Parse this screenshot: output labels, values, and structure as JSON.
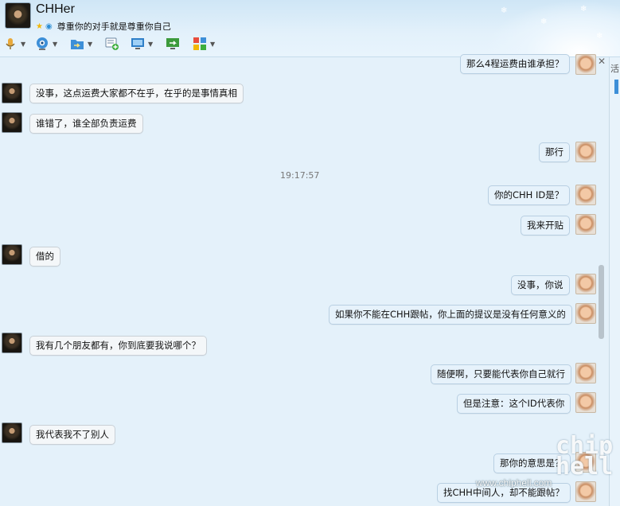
{
  "header": {
    "contact_name": "CHHer",
    "signature": "尊重你的对手就是尊重你自己",
    "icons": [
      "microphone-icon",
      "video-camera-icon",
      "folder-transfer-icon",
      "message-add-icon",
      "screen-share-icon",
      "remote-assist-icon",
      "apps-grid-icon"
    ]
  },
  "timestamp": "19:17:57",
  "messages": [
    {
      "side": "me",
      "text": "那么4程运费由谁承担？"
    },
    {
      "side": "them",
      "text": "没事，这点运费大家都不在乎，在乎的是事情真相"
    },
    {
      "side": "them",
      "text": "谁错了，谁全部负责运费"
    },
    {
      "side": "me",
      "text": "那行"
    },
    {
      "side": "me",
      "text": "你的CHH ID是？"
    },
    {
      "side": "me",
      "text": "我来开贴"
    },
    {
      "side": "them",
      "text": "借的"
    },
    {
      "side": "me",
      "text": "没事，你说"
    },
    {
      "side": "me",
      "text": "如果你不能在CHH跟帖，你上面的提议是没有任何意义的"
    },
    {
      "side": "them",
      "text": "我有几个朋友都有，你到底要我说哪个？"
    },
    {
      "side": "me",
      "text": "随便啊，只要能代表你自己就行"
    },
    {
      "side": "me",
      "text": "但是注意：这个ID代表你"
    },
    {
      "side": "them",
      "text": "我代表我不了别人"
    },
    {
      "side": "me",
      "text": "那你的意思是？"
    },
    {
      "side": "me",
      "text": "找CHH中间人，却不能跟帖？"
    }
  ],
  "sidebar": {
    "partial_text": "活"
  },
  "watermark": {
    "logo": "chip hell",
    "url": "www.chiphell.com"
  },
  "colors": {
    "background": "#e4f1fa",
    "bubble_border": "#c3d5e3",
    "accent": "#3d8fd8"
  }
}
